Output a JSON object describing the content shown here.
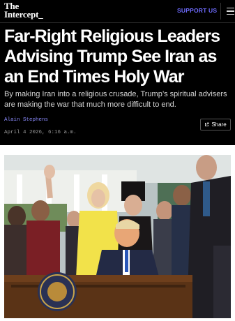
{
  "header": {
    "logo_line1": "The",
    "logo_line2": "Intercept_",
    "support_label": "SUPPORT US",
    "menu_icon": "hamburger-menu-icon"
  },
  "article": {
    "headline": "Far-Right Religious Leaders Advising Trump See Iran as an End Times Holy War",
    "dek": "By making Iran into a religious crusade, Trump’s spiritual advisers are making the war that much more difficult to end.",
    "author": "Alain Stephens",
    "date": "April 4 2026, 6:16 a.m.",
    "share_label": "Share"
  },
  "colors": {
    "background": "#000000",
    "accent": "#6f6cff",
    "author_link": "#8c8cff"
  }
}
